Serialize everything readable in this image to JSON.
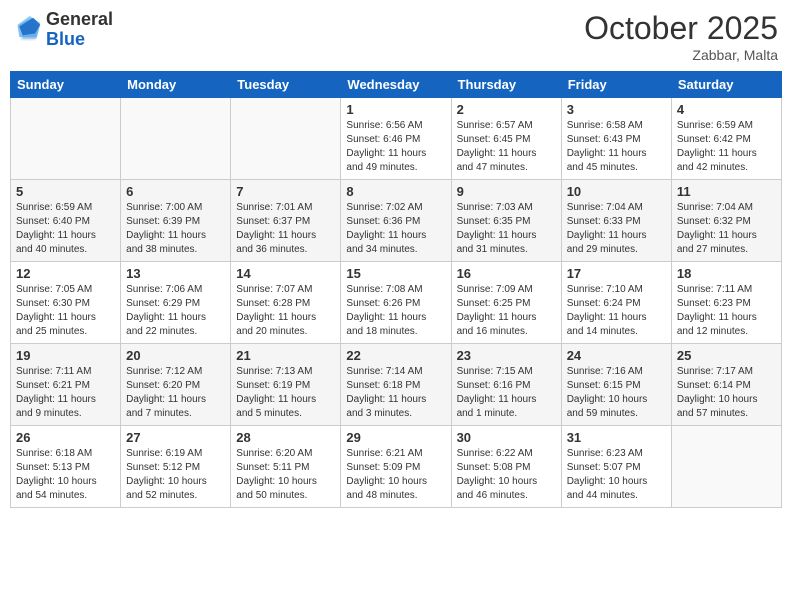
{
  "header": {
    "logo_general": "General",
    "logo_blue": "Blue",
    "month_title": "October 2025",
    "subtitle": "Zabbar, Malta"
  },
  "days_of_week": [
    "Sunday",
    "Monday",
    "Tuesday",
    "Wednesday",
    "Thursday",
    "Friday",
    "Saturday"
  ],
  "weeks": [
    [
      {
        "day": "",
        "info": ""
      },
      {
        "day": "",
        "info": ""
      },
      {
        "day": "",
        "info": ""
      },
      {
        "day": "1",
        "info": "Sunrise: 6:56 AM\nSunset: 6:46 PM\nDaylight: 11 hours\nand 49 minutes."
      },
      {
        "day": "2",
        "info": "Sunrise: 6:57 AM\nSunset: 6:45 PM\nDaylight: 11 hours\nand 47 minutes."
      },
      {
        "day": "3",
        "info": "Sunrise: 6:58 AM\nSunset: 6:43 PM\nDaylight: 11 hours\nand 45 minutes."
      },
      {
        "day": "4",
        "info": "Sunrise: 6:59 AM\nSunset: 6:42 PM\nDaylight: 11 hours\nand 42 minutes."
      }
    ],
    [
      {
        "day": "5",
        "info": "Sunrise: 6:59 AM\nSunset: 6:40 PM\nDaylight: 11 hours\nand 40 minutes."
      },
      {
        "day": "6",
        "info": "Sunrise: 7:00 AM\nSunset: 6:39 PM\nDaylight: 11 hours\nand 38 minutes."
      },
      {
        "day": "7",
        "info": "Sunrise: 7:01 AM\nSunset: 6:37 PM\nDaylight: 11 hours\nand 36 minutes."
      },
      {
        "day": "8",
        "info": "Sunrise: 7:02 AM\nSunset: 6:36 PM\nDaylight: 11 hours\nand 34 minutes."
      },
      {
        "day": "9",
        "info": "Sunrise: 7:03 AM\nSunset: 6:35 PM\nDaylight: 11 hours\nand 31 minutes."
      },
      {
        "day": "10",
        "info": "Sunrise: 7:04 AM\nSunset: 6:33 PM\nDaylight: 11 hours\nand 29 minutes."
      },
      {
        "day": "11",
        "info": "Sunrise: 7:04 AM\nSunset: 6:32 PM\nDaylight: 11 hours\nand 27 minutes."
      }
    ],
    [
      {
        "day": "12",
        "info": "Sunrise: 7:05 AM\nSunset: 6:30 PM\nDaylight: 11 hours\nand 25 minutes."
      },
      {
        "day": "13",
        "info": "Sunrise: 7:06 AM\nSunset: 6:29 PM\nDaylight: 11 hours\nand 22 minutes."
      },
      {
        "day": "14",
        "info": "Sunrise: 7:07 AM\nSunset: 6:28 PM\nDaylight: 11 hours\nand 20 minutes."
      },
      {
        "day": "15",
        "info": "Sunrise: 7:08 AM\nSunset: 6:26 PM\nDaylight: 11 hours\nand 18 minutes."
      },
      {
        "day": "16",
        "info": "Sunrise: 7:09 AM\nSunset: 6:25 PM\nDaylight: 11 hours\nand 16 minutes."
      },
      {
        "day": "17",
        "info": "Sunrise: 7:10 AM\nSunset: 6:24 PM\nDaylight: 11 hours\nand 14 minutes."
      },
      {
        "day": "18",
        "info": "Sunrise: 7:11 AM\nSunset: 6:23 PM\nDaylight: 11 hours\nand 12 minutes."
      }
    ],
    [
      {
        "day": "19",
        "info": "Sunrise: 7:11 AM\nSunset: 6:21 PM\nDaylight: 11 hours\nand 9 minutes."
      },
      {
        "day": "20",
        "info": "Sunrise: 7:12 AM\nSunset: 6:20 PM\nDaylight: 11 hours\nand 7 minutes."
      },
      {
        "day": "21",
        "info": "Sunrise: 7:13 AM\nSunset: 6:19 PM\nDaylight: 11 hours\nand 5 minutes."
      },
      {
        "day": "22",
        "info": "Sunrise: 7:14 AM\nSunset: 6:18 PM\nDaylight: 11 hours\nand 3 minutes."
      },
      {
        "day": "23",
        "info": "Sunrise: 7:15 AM\nSunset: 6:16 PM\nDaylight: 11 hours\nand 1 minute."
      },
      {
        "day": "24",
        "info": "Sunrise: 7:16 AM\nSunset: 6:15 PM\nDaylight: 10 hours\nand 59 minutes."
      },
      {
        "day": "25",
        "info": "Sunrise: 7:17 AM\nSunset: 6:14 PM\nDaylight: 10 hours\nand 57 minutes."
      }
    ],
    [
      {
        "day": "26",
        "info": "Sunrise: 6:18 AM\nSunset: 5:13 PM\nDaylight: 10 hours\nand 54 minutes."
      },
      {
        "day": "27",
        "info": "Sunrise: 6:19 AM\nSunset: 5:12 PM\nDaylight: 10 hours\nand 52 minutes."
      },
      {
        "day": "28",
        "info": "Sunrise: 6:20 AM\nSunset: 5:11 PM\nDaylight: 10 hours\nand 50 minutes."
      },
      {
        "day": "29",
        "info": "Sunrise: 6:21 AM\nSunset: 5:09 PM\nDaylight: 10 hours\nand 48 minutes."
      },
      {
        "day": "30",
        "info": "Sunrise: 6:22 AM\nSunset: 5:08 PM\nDaylight: 10 hours\nand 46 minutes."
      },
      {
        "day": "31",
        "info": "Sunrise: 6:23 AM\nSunset: 5:07 PM\nDaylight: 10 hours\nand 44 minutes."
      },
      {
        "day": "",
        "info": ""
      }
    ]
  ]
}
